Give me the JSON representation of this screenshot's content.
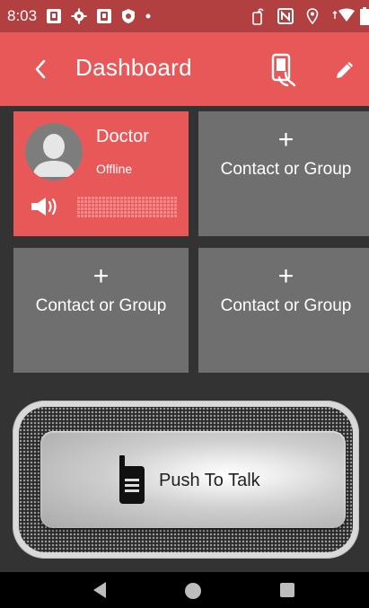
{
  "status_bar": {
    "time": "8:03",
    "left_icons": [
      "app-notification-icon",
      "settings-icon",
      "app-notification-icon",
      "shield-icon",
      "dot-icon"
    ],
    "right_icons": [
      "nfc-tap-icon",
      "nfc-icon",
      "location-icon",
      "wifi-icon",
      "battery-icon"
    ]
  },
  "app_bar": {
    "title": "Dashboard",
    "color": "#e85858",
    "back_icon": "chevron-left-icon",
    "nfc_icon": "nfc-phone-icon",
    "edit_icon": "pencil-icon"
  },
  "tiles": [
    {
      "name": "Doctor",
      "status": "Offline",
      "active": true,
      "color": "#e85858"
    },
    {
      "add": "+",
      "label": "Contact or Group",
      "color": "#6f6f6f"
    },
    {
      "add": "+",
      "label": "Contact or Group",
      "color": "#6f6f6f"
    },
    {
      "add": "+",
      "label": "Contact or Group",
      "color": "#6f6f6f"
    }
  ],
  "ptt": {
    "label": "Push To Talk",
    "icon": "walkie-talkie-icon"
  },
  "nav_bar": {
    "icons": [
      "nav-back-icon",
      "nav-home-icon",
      "nav-recents-icon"
    ]
  }
}
